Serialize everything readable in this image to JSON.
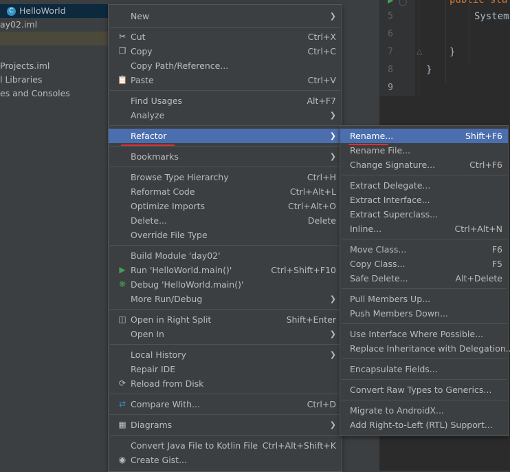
{
  "tree": {
    "rows": [
      {
        "label": "HelloWorld",
        "selected": true
      },
      {
        "label": "ay02.iml"
      },
      {
        "label": ""
      },
      {
        "label": "Projects.iml"
      },
      {
        "label": "l Libraries"
      },
      {
        "label": "es and Consoles"
      }
    ]
  },
  "editor": {
    "line_numbers": [
      "5",
      "6",
      "7",
      "8",
      "9"
    ],
    "code": {
      "line0": "public sta",
      "line5": "System",
      "line7": "}",
      "line8": "}"
    }
  },
  "main_menu": {
    "items": [
      {
        "label": "New",
        "shortcut": "",
        "submenu": true
      },
      {
        "label": "Cut",
        "shortcut": "Ctrl+X",
        "icon": "scissors-icon"
      },
      {
        "label": "Copy",
        "shortcut": "Ctrl+C",
        "icon": "copy-icon"
      },
      {
        "label": "Copy Path/Reference...",
        "shortcut": ""
      },
      {
        "label": "Paste",
        "shortcut": "Ctrl+V",
        "icon": "clipboard-icon"
      },
      {
        "label": "Find Usages",
        "shortcut": "Alt+F7"
      },
      {
        "label": "Analyze",
        "shortcut": "",
        "submenu": true
      },
      {
        "label": "Refactor",
        "shortcut": "",
        "submenu": true,
        "active": true
      },
      {
        "label": "Bookmarks",
        "shortcut": "",
        "submenu": true
      },
      {
        "label": "Browse Type Hierarchy",
        "shortcut": "Ctrl+H"
      },
      {
        "label": "Reformat Code",
        "shortcut": "Ctrl+Alt+L"
      },
      {
        "label": "Optimize Imports",
        "shortcut": "Ctrl+Alt+O"
      },
      {
        "label": "Delete...",
        "shortcut": "Delete"
      },
      {
        "label": "Override File Type",
        "shortcut": ""
      },
      {
        "label": "Build Module 'day02'",
        "shortcut": ""
      },
      {
        "label": "Run 'HelloWorld.main()'",
        "shortcut": "Ctrl+Shift+F10",
        "icon": "run-icon"
      },
      {
        "label": "Debug 'HelloWorld.main()'",
        "shortcut": "",
        "icon": "bug-icon"
      },
      {
        "label": "More Run/Debug",
        "shortcut": "",
        "submenu": true
      },
      {
        "label": "Open in Right Split",
        "shortcut": "Shift+Enter",
        "icon": "split-icon"
      },
      {
        "label": "Open In",
        "shortcut": "",
        "submenu": true
      },
      {
        "label": "Local History",
        "shortcut": "",
        "submenu": true
      },
      {
        "label": "Repair IDE",
        "shortcut": ""
      },
      {
        "label": "Reload from Disk",
        "shortcut": "",
        "icon": "reload-icon"
      },
      {
        "label": "Compare With...",
        "shortcut": "Ctrl+D",
        "icon": "compare-icon"
      },
      {
        "label": "Diagrams",
        "shortcut": "",
        "submenu": true,
        "icon": "diagram-icon"
      },
      {
        "label": "Convert Java File to Kotlin File",
        "shortcut": "Ctrl+Alt+Shift+K"
      },
      {
        "label": "Create Gist...",
        "shortcut": "",
        "icon": "github-icon"
      }
    ]
  },
  "refactor_menu": {
    "items": [
      {
        "label": "Rename...",
        "shortcut": "Shift+F6",
        "active": true
      },
      {
        "label": "Rename File...",
        "shortcut": ""
      },
      {
        "label": "Change Signature...",
        "shortcut": "Ctrl+F6"
      },
      {
        "label": "Extract Delegate...",
        "shortcut": ""
      },
      {
        "label": "Extract Interface...",
        "shortcut": ""
      },
      {
        "label": "Extract Superclass...",
        "shortcut": ""
      },
      {
        "label": "Inline...",
        "shortcut": "Ctrl+Alt+N"
      },
      {
        "label": "Move Class...",
        "shortcut": "F6"
      },
      {
        "label": "Copy Class...",
        "shortcut": "F5"
      },
      {
        "label": "Safe Delete...",
        "shortcut": "Alt+Delete"
      },
      {
        "label": "Pull Members Up...",
        "shortcut": ""
      },
      {
        "label": "Push Members Down...",
        "shortcut": ""
      },
      {
        "label": "Use Interface Where Possible...",
        "shortcut": ""
      },
      {
        "label": "Replace Inheritance with Delegation...",
        "shortcut": ""
      },
      {
        "label": "Encapsulate Fields...",
        "shortcut": ""
      },
      {
        "label": "Convert Raw Types to Generics...",
        "shortcut": ""
      },
      {
        "label": "Migrate to AndroidX...",
        "shortcut": ""
      },
      {
        "label": "Add Right-to-Left (RTL) Support...",
        "shortcut": ""
      }
    ]
  },
  "colors": {
    "menu_bg": "#3c3f41",
    "selection": "#4b6eaf",
    "annotation_underline": "#e0312f"
  }
}
